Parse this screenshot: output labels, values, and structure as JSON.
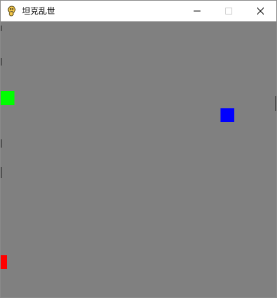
{
  "window": {
    "title": "坦克乱世",
    "icon": "pygame-snake-icon",
    "controls": [
      "minimize-icon",
      "maximize-icon",
      "close-icon"
    ]
  },
  "game": {
    "background_color": "#808080",
    "tanks": [
      {
        "name": "green-tank",
        "color": "#00ff00"
      },
      {
        "name": "blue-tank",
        "color": "#0000ff"
      },
      {
        "name": "red-tank",
        "color": "#ff0000"
      }
    ]
  }
}
